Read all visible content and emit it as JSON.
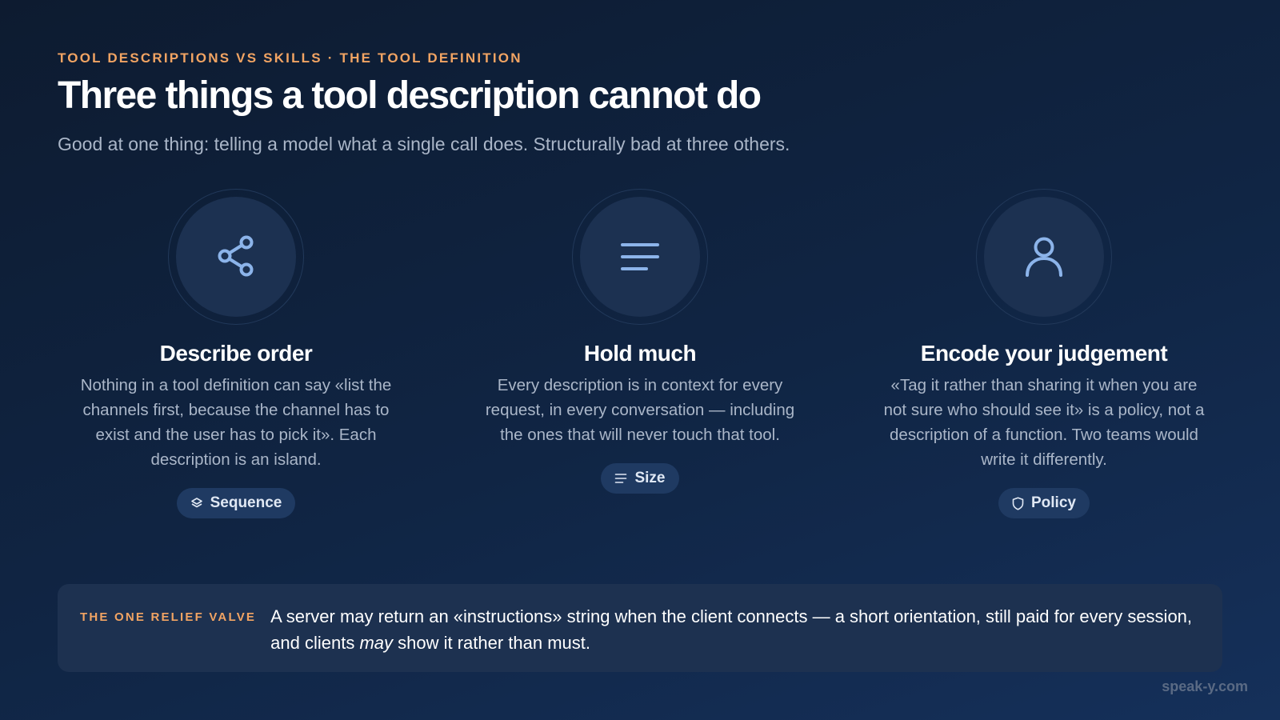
{
  "header": {
    "eyebrow": "TOOL DESCRIPTIONS VS SKILLS · THE TOOL DEFINITION",
    "title": "Three things a tool description cannot do",
    "subtitle": "Good at one thing: telling a model what a single call does. Structurally bad at three others."
  },
  "columns": [
    {
      "icon": "share-icon",
      "title": "Describe order",
      "body": "Nothing in a tool definition can say «list the channels first, because the channel has to exist and the user has to pick it». Each description is an island.",
      "pill_icon": "layers-icon",
      "pill_label": "Sequence"
    },
    {
      "icon": "lines-icon",
      "title": "Hold much",
      "body": "Every description is in context for every request, in every conversation — including the ones that will never touch that tool.",
      "pill_icon": "lines-icon",
      "pill_label": "Size"
    },
    {
      "icon": "user-icon",
      "title": "Encode your judgement",
      "body": "«Tag it rather than sharing it when you are not sure who should see it» is a policy, not a description of a function. Two teams would write it differently.",
      "pill_icon": "shield-icon",
      "pill_label": "Policy"
    }
  ],
  "callout": {
    "label": "THE ONE RELIEF VALVE",
    "text_before": "A server may return an «instructions» string when the client connects — a short orientation, still paid for every session, and clients ",
    "text_emphasis": "may",
    "text_after": " show it rather than must."
  },
  "footer": {
    "brand": "speak-y.com"
  },
  "colors": {
    "accent": "#f2a463",
    "icon": "#8cb4ea",
    "background": "#102544"
  }
}
